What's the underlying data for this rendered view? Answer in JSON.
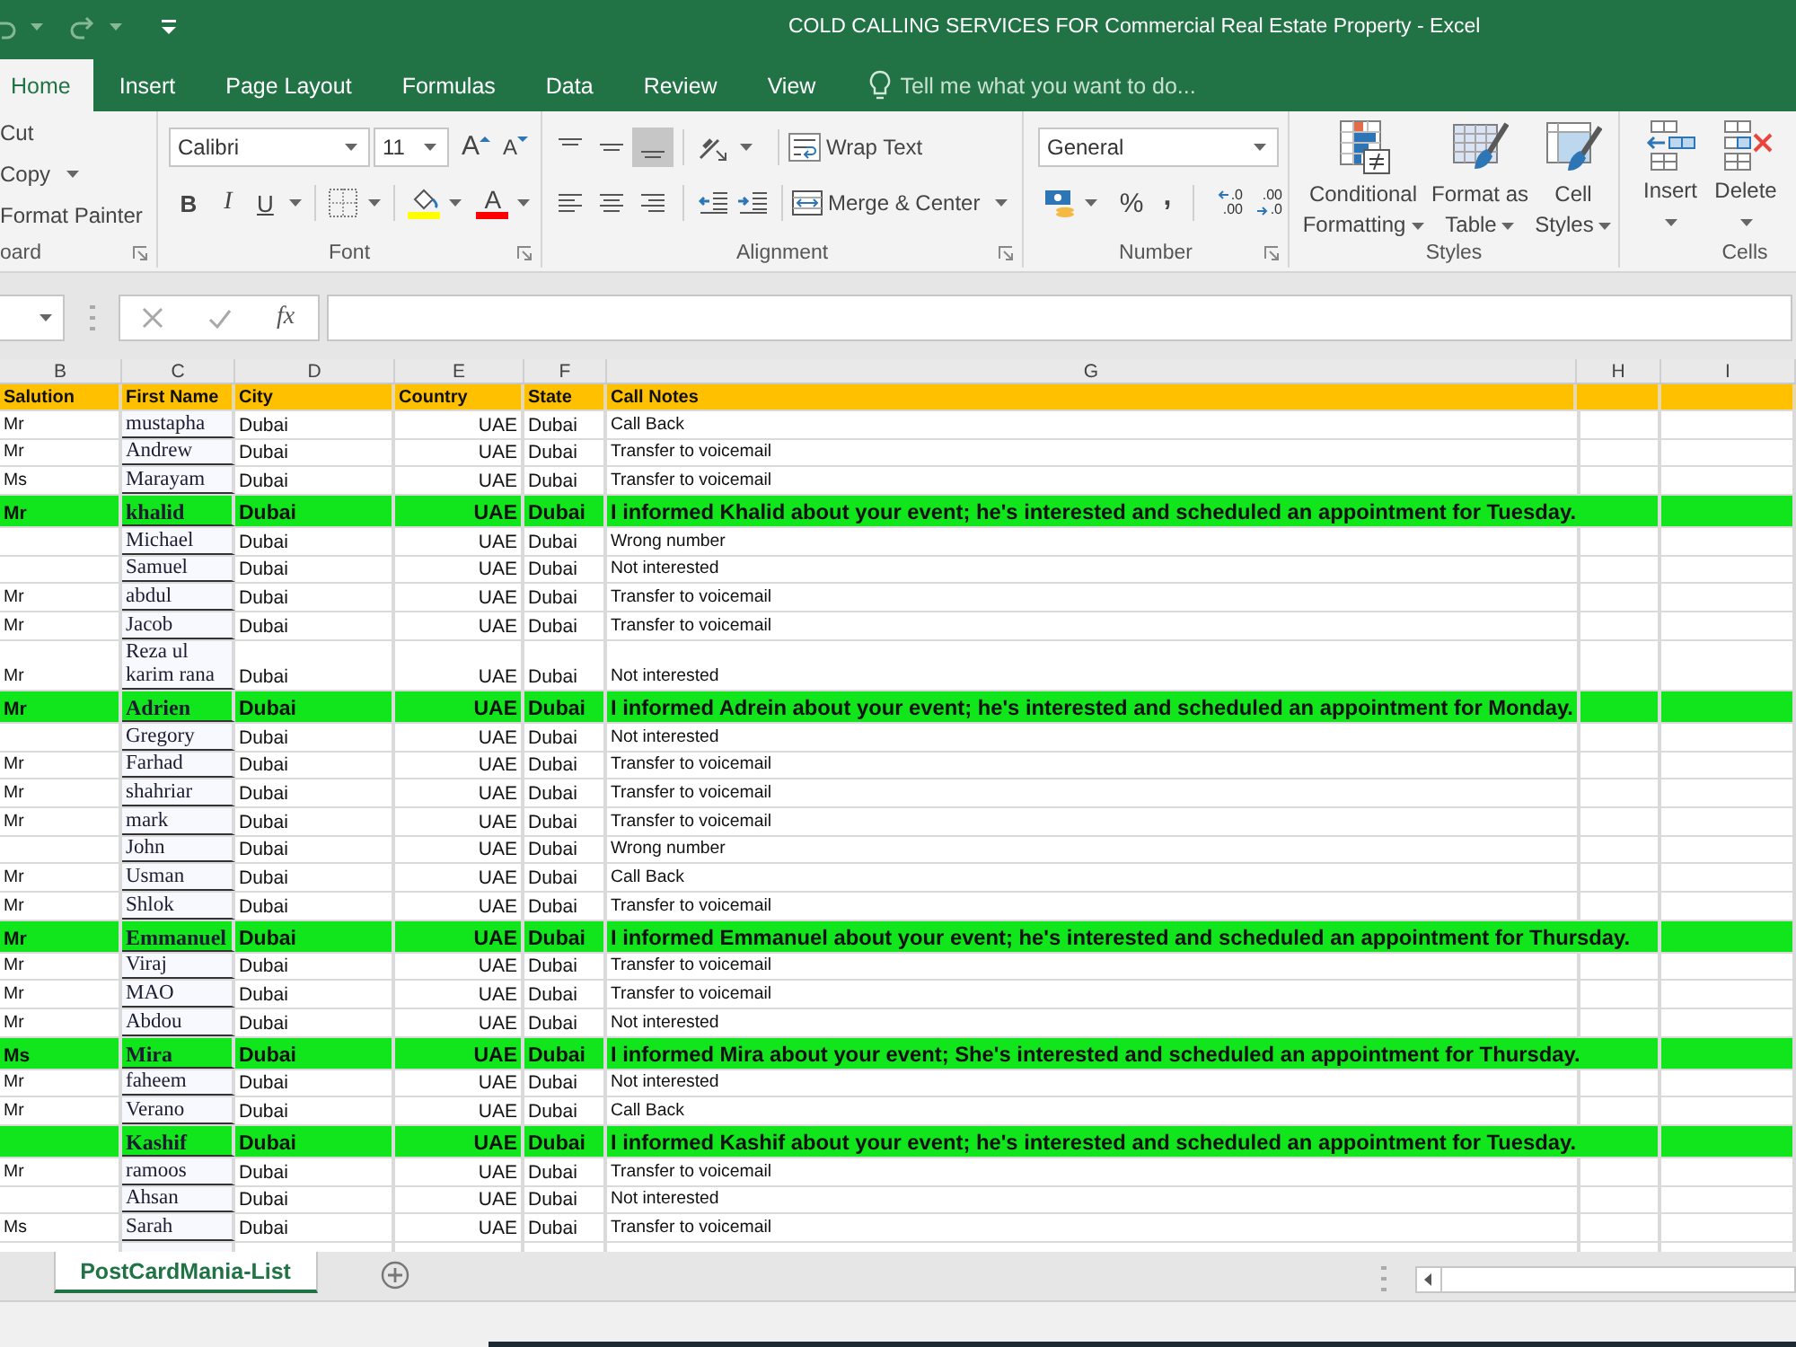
{
  "window": {
    "title": "COLD CALLING SERVICES FOR Commercial Real Estate Property - Excel"
  },
  "ribbon_tabs": [
    {
      "label": "Home",
      "selected": true
    },
    {
      "label": "Insert",
      "selected": false
    },
    {
      "label": "Page Layout",
      "selected": false
    },
    {
      "label": "Formulas",
      "selected": false
    },
    {
      "label": "Data",
      "selected": false
    },
    {
      "label": "Review",
      "selected": false
    },
    {
      "label": "View",
      "selected": false
    }
  ],
  "tell_me": {
    "placeholder": "Tell me what you want to do..."
  },
  "ribbon": {
    "clipboard": {
      "cut": "Cut",
      "copy": "Copy",
      "format_painter": "Format Painter",
      "label": "oard"
    },
    "font": {
      "font_name": "Calibri",
      "font_size": "11",
      "grow_font": "A",
      "shrink_font": "A",
      "bold": "B",
      "italic": "I",
      "underline": "U",
      "font_color": "A",
      "label": "Font"
    },
    "alignment": {
      "vertical_align": [
        {
          "kind": "top",
          "selected": false
        },
        {
          "kind": "middle",
          "selected": false
        },
        {
          "kind": "bottom",
          "selected": true
        }
      ],
      "wrap_text": "Wrap Text",
      "merge_center": "Merge & Center",
      "label": "Alignment"
    },
    "number": {
      "format": "General",
      "percent": "%",
      "comma": ",",
      "increase_decimal": [
        ".0",
        ".00"
      ],
      "decrease_decimal": [
        ".00",
        ".0"
      ],
      "label": "Number"
    },
    "styles": {
      "buttons": [
        {
          "kind": "conditional",
          "label": "Conditional Formatting"
        },
        {
          "kind": "table",
          "label": "Format as Table"
        },
        {
          "kind": "cell",
          "label": "Cell Styles"
        }
      ],
      "label": "Styles"
    },
    "cells": {
      "buttons": [
        {
          "kind": "insert",
          "label": "Insert"
        },
        {
          "kind": "delete",
          "label": "Delete"
        }
      ],
      "label": "Cells"
    }
  },
  "formula_bar": {
    "function_button": "fx"
  },
  "sheet": {
    "columns": [
      {
        "letter": "B",
        "heading": "Salution"
      },
      {
        "letter": "C",
        "heading": "First Name"
      },
      {
        "letter": "D",
        "heading": "City"
      },
      {
        "letter": "E",
        "heading": "Country"
      },
      {
        "letter": "F",
        "heading": "State"
      },
      {
        "letter": "G",
        "heading": "Call Notes"
      },
      {
        "letter": "H"
      },
      {
        "letter": "I"
      }
    ],
    "rows": [
      {
        "salutation": "Mr",
        "first_name": "mustapha",
        "city": "Dubai",
        "country": "UAE",
        "state": "Dubai",
        "call_notes": "Call Back",
        "highlighted": false
      },
      {
        "salutation": "Mr",
        "first_name": "Andrew",
        "city": "Dubai",
        "country": "UAE",
        "state": "Dubai",
        "call_notes": "Transfer to voicemail",
        "highlighted": false
      },
      {
        "salutation": "Ms",
        "first_name": "Marayam",
        "city": "Dubai",
        "country": "UAE",
        "state": "Dubai",
        "call_notes": "Transfer to voicemail",
        "highlighted": false
      },
      {
        "salutation": "Mr",
        "first_name": "khalid",
        "city": "Dubai",
        "country": "UAE",
        "state": "Dubai",
        "call_notes": "I informed Khalid about your event; he's interested and scheduled an appointment for Tuesday.",
        "highlighted": true
      },
      {
        "first_name": "Michael",
        "city": "Dubai",
        "country": "UAE",
        "state": "Dubai",
        "call_notes": "Wrong number",
        "highlighted": false
      },
      {
        "first_name": "Samuel",
        "city": "Dubai",
        "country": "UAE",
        "state": "Dubai",
        "call_notes": "Not interested",
        "highlighted": false
      },
      {
        "salutation": "Mr",
        "first_name": "abdul",
        "city": "Dubai",
        "country": "UAE",
        "state": "Dubai",
        "call_notes": "Transfer to voicemail",
        "highlighted": false
      },
      {
        "salutation": "Mr",
        "first_name": "Jacob",
        "city": "Dubai",
        "country": "UAE",
        "state": "Dubai",
        "call_notes": "Transfer to voicemail",
        "highlighted": false
      },
      {
        "salutation": "Mr",
        "first_name": "Reza ul karim rana",
        "city": "Dubai",
        "country": "UAE",
        "state": "Dubai",
        "call_notes": "Not interested",
        "highlighted": false
      },
      {
        "salutation": "Mr",
        "first_name": "Adrien",
        "city": "Dubai",
        "country": "UAE",
        "state": "Dubai",
        "call_notes": "I informed Adrein about your event; he's interested and scheduled an appointment for Monday.",
        "highlighted": true
      },
      {
        "first_name": "Gregory",
        "city": "Dubai",
        "country": "UAE",
        "state": "Dubai",
        "call_notes": "Not interested",
        "highlighted": false
      },
      {
        "salutation": "Mr",
        "first_name": "Farhad",
        "city": "Dubai",
        "country": "UAE",
        "state": "Dubai",
        "call_notes": "Transfer to voicemail",
        "highlighted": false
      },
      {
        "salutation": "Mr",
        "first_name": "shahriar",
        "city": "Dubai",
        "country": "UAE",
        "state": "Dubai",
        "call_notes": "Transfer to voicemail",
        "highlighted": false
      },
      {
        "salutation": "Mr",
        "first_name": "mark",
        "city": "Dubai",
        "country": "UAE",
        "state": "Dubai",
        "call_notes": "Transfer to voicemail",
        "highlighted": false
      },
      {
        "first_name": "John",
        "city": "Dubai",
        "country": "UAE",
        "state": "Dubai",
        "call_notes": "Wrong number",
        "highlighted": false
      },
      {
        "salutation": "Mr",
        "first_name": "Usman",
        "city": "Dubai",
        "country": "UAE",
        "state": "Dubai",
        "call_notes": "Call Back",
        "highlighted": false
      },
      {
        "salutation": "Mr",
        "first_name": "Shlok",
        "city": "Dubai",
        "country": "UAE",
        "state": "Dubai",
        "call_notes": "Transfer to voicemail",
        "highlighted": false
      },
      {
        "salutation": "Mr",
        "first_name": "Emmanuel",
        "city": "Dubai",
        "country": "UAE",
        "state": "Dubai",
        "call_notes": "I informed Emmanuel about your event; he's interested and scheduled an appointment for Thursday.",
        "highlighted": true
      },
      {
        "salutation": "Mr",
        "first_name": "Viraj",
        "city": "Dubai",
        "country": "UAE",
        "state": "Dubai",
        "call_notes": "Transfer to voicemail",
        "highlighted": false
      },
      {
        "salutation": "Mr",
        "first_name": "MAO",
        "city": "Dubai",
        "country": "UAE",
        "state": "Dubai",
        "call_notes": "Transfer to voicemail",
        "highlighted": false
      },
      {
        "salutation": "Mr",
        "first_name": "Abdou",
        "city": "Dubai",
        "country": "UAE",
        "state": "Dubai",
        "call_notes": "Not interested",
        "highlighted": false
      },
      {
        "salutation": "Ms",
        "first_name": "Mira",
        "city": "Dubai",
        "country": "UAE",
        "state": "Dubai",
        "call_notes": "I informed Mira about your event; She's interested and scheduled an appointment for Thursday.",
        "highlighted": true
      },
      {
        "salutation": "Mr",
        "first_name": "faheem",
        "city": "Dubai",
        "country": "UAE",
        "state": "Dubai",
        "call_notes": "Not interested",
        "highlighted": false
      },
      {
        "salutation": "Mr",
        "first_name": "Verano",
        "city": "Dubai",
        "country": "UAE",
        "state": "Dubai",
        "call_notes": "Call Back",
        "highlighted": false
      },
      {
        "first_name": "Kashif",
        "city": "Dubai",
        "country": "UAE",
        "state": "Dubai",
        "call_notes": "I informed Kashif about your event; he's interested and scheduled an appointment for Tuesday.",
        "highlighted": true
      },
      {
        "salutation": "Mr",
        "first_name": "ramoos",
        "city": "Dubai",
        "country": "UAE",
        "state": "Dubai",
        "call_notes": "Transfer to voicemail",
        "highlighted": false
      },
      {
        "first_name": "Ahsan",
        "city": "Dubai",
        "country": "UAE",
        "state": "Dubai",
        "call_notes": "Not interested",
        "highlighted": false
      },
      {
        "salutation": "Ms",
        "first_name": "Sarah",
        "city": "Dubai",
        "country": "UAE",
        "state": "Dubai",
        "call_notes": "Transfer to voicemail",
        "highlighted": false
      }
    ]
  },
  "sheet_tabs": [
    {
      "label": "PostCardMania-List",
      "selected": true
    }
  ]
}
